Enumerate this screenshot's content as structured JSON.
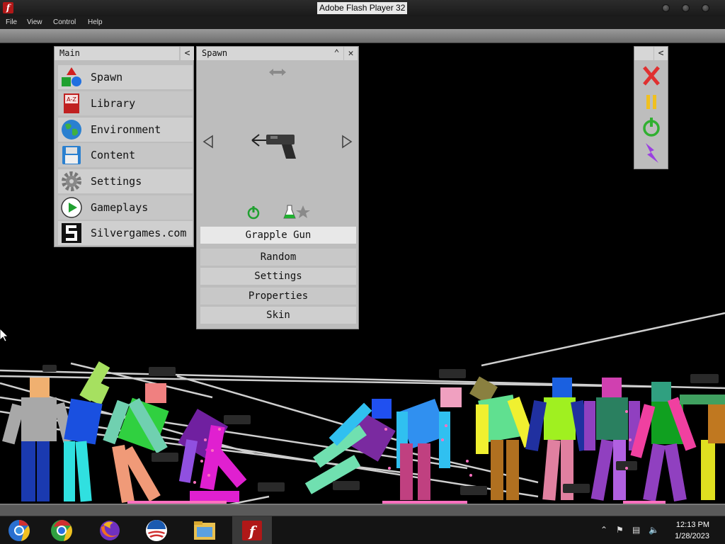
{
  "window": {
    "title": "Adobe Flash Player 32"
  },
  "menu": {
    "items": [
      "File",
      "View",
      "Control",
      "Help"
    ]
  },
  "main_panel": {
    "title": "Main",
    "items": [
      {
        "label": "Spawn",
        "icon": "shapes-icon"
      },
      {
        "label": "Library",
        "icon": "book-icon"
      },
      {
        "label": "Environment",
        "icon": "globe-icon"
      },
      {
        "label": "Content",
        "icon": "floppy-icon"
      },
      {
        "label": "Settings",
        "icon": "gear-icon"
      },
      {
        "label": "Gameplays",
        "icon": "play-icon"
      },
      {
        "label": "Silvergames.com",
        "icon": "silvergames-logo-icon"
      }
    ]
  },
  "spawn_panel": {
    "title": "Spawn",
    "selected_item": "Grapple Gun",
    "buttons": [
      "Random",
      "Settings",
      "Properties",
      "Skin"
    ]
  },
  "toolbar_panel": {
    "tools": [
      "close-icon",
      "pause-icon",
      "power-icon",
      "lightning-icon"
    ],
    "colors": {
      "close": "#e03030",
      "pause": "#f0c020",
      "power": "#30b030",
      "lightning": "#9a40e0"
    }
  },
  "taskbar": {
    "apps": [
      "chrome-beta-icon",
      "chrome-icon",
      "firefox-icon",
      "obama-logo-icon",
      "file-explorer-icon",
      "flash-player-icon"
    ],
    "time": "12:13 PM",
    "date": "1/28/2023"
  }
}
